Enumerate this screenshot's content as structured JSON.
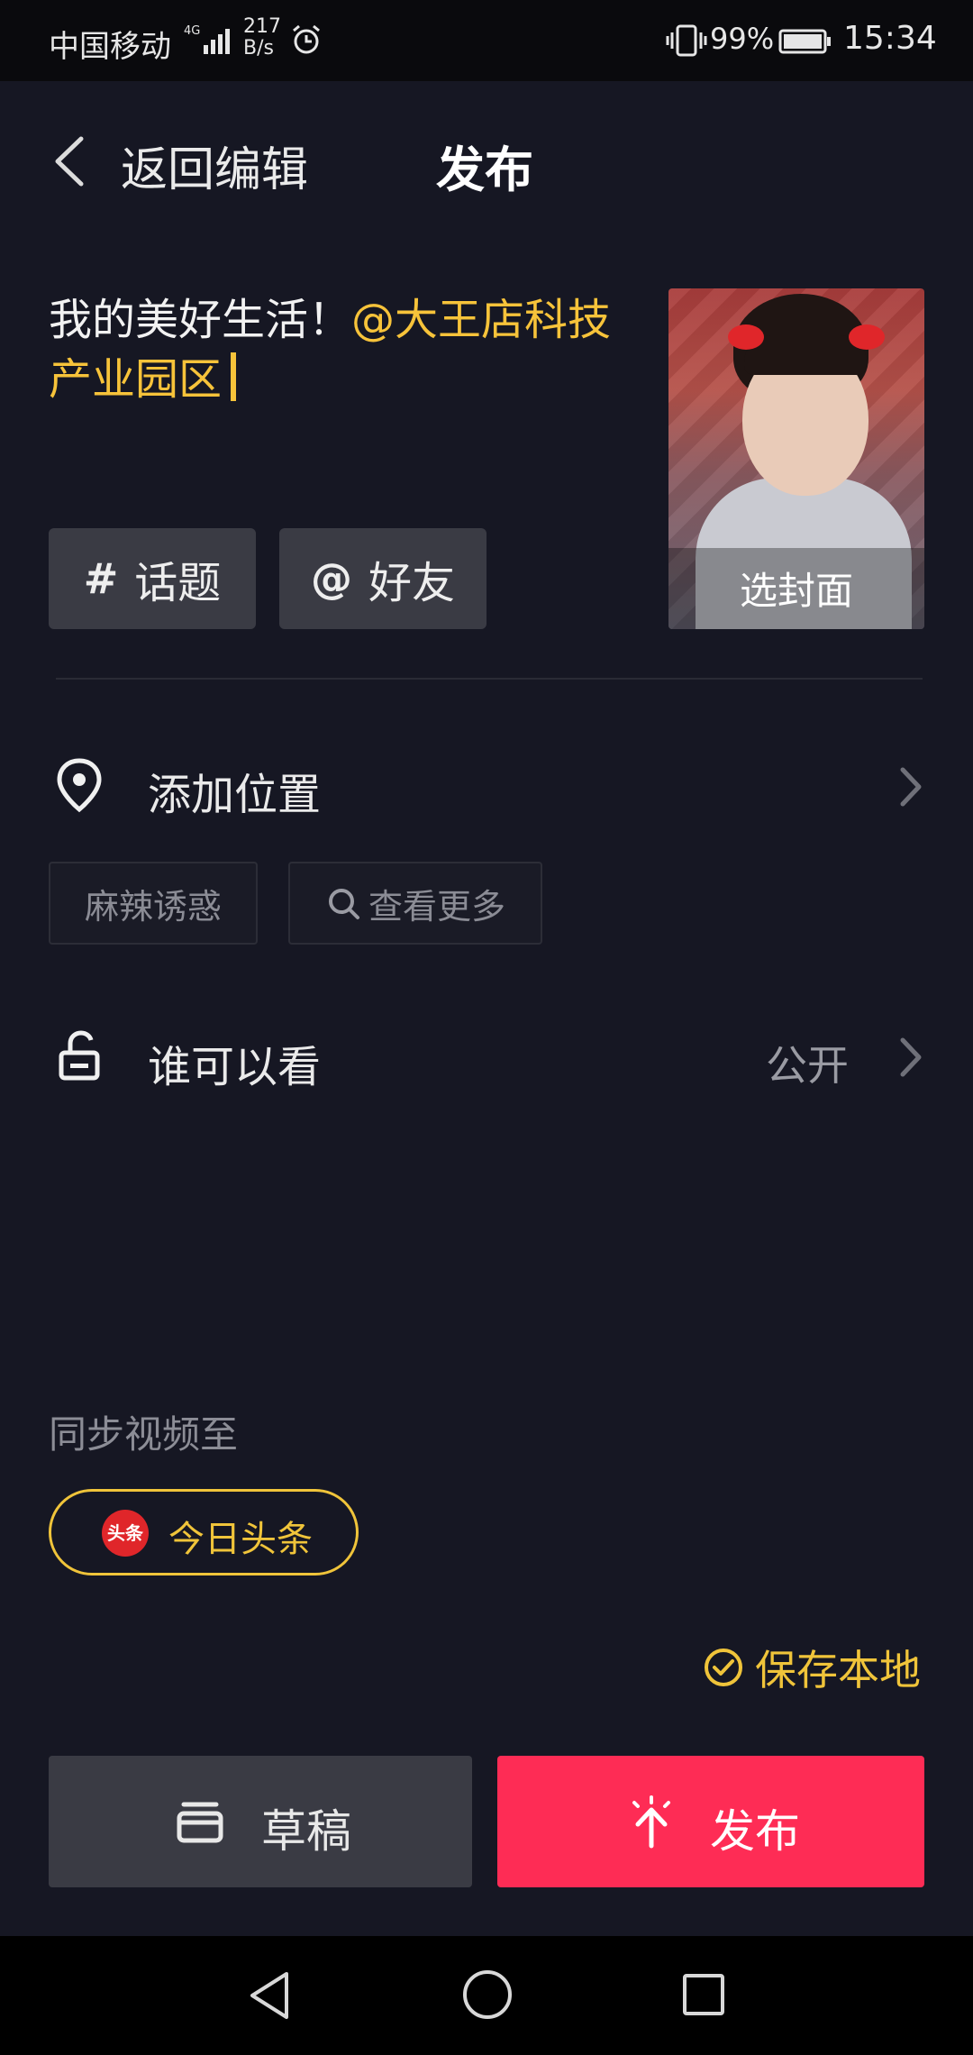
{
  "status_bar": {
    "carrier": "中国移动",
    "network": "4G",
    "speed_value": "217",
    "speed_unit": "B/s",
    "battery": "99%",
    "time": "15:34"
  },
  "header": {
    "back_label": "返回编辑",
    "title": "发布"
  },
  "caption": {
    "text": "我的美好生活！",
    "mention": "@大王店科技产业园区"
  },
  "cover": {
    "label": "选封面"
  },
  "tags": {
    "topic_symbol": "#",
    "topic_label": "话题",
    "friend_symbol": "@",
    "friend_label": "好友"
  },
  "location": {
    "label": "添加位置",
    "suggestions": [
      "麻辣诱惑",
      "查看更多"
    ]
  },
  "visibility": {
    "label": "谁可以看",
    "value": "公开"
  },
  "sync": {
    "label": "同步视频至",
    "target": "今日头条",
    "target_logo_text": "头条"
  },
  "save_local": {
    "label": "保存本地"
  },
  "actions": {
    "draft": "草稿",
    "publish": "发布"
  },
  "colors": {
    "background": "#161723",
    "accent_yellow": "#f7c33a",
    "publish_red": "#fe2c55",
    "button_gray": "#3a3b44"
  },
  "icons": [
    "chevron-left-icon",
    "location-pin-icon",
    "search-icon",
    "unlock-icon",
    "chevron-right-icon",
    "check-circle-icon",
    "draft-box-icon",
    "publish-arrow-icon",
    "toutiao-logo"
  ]
}
